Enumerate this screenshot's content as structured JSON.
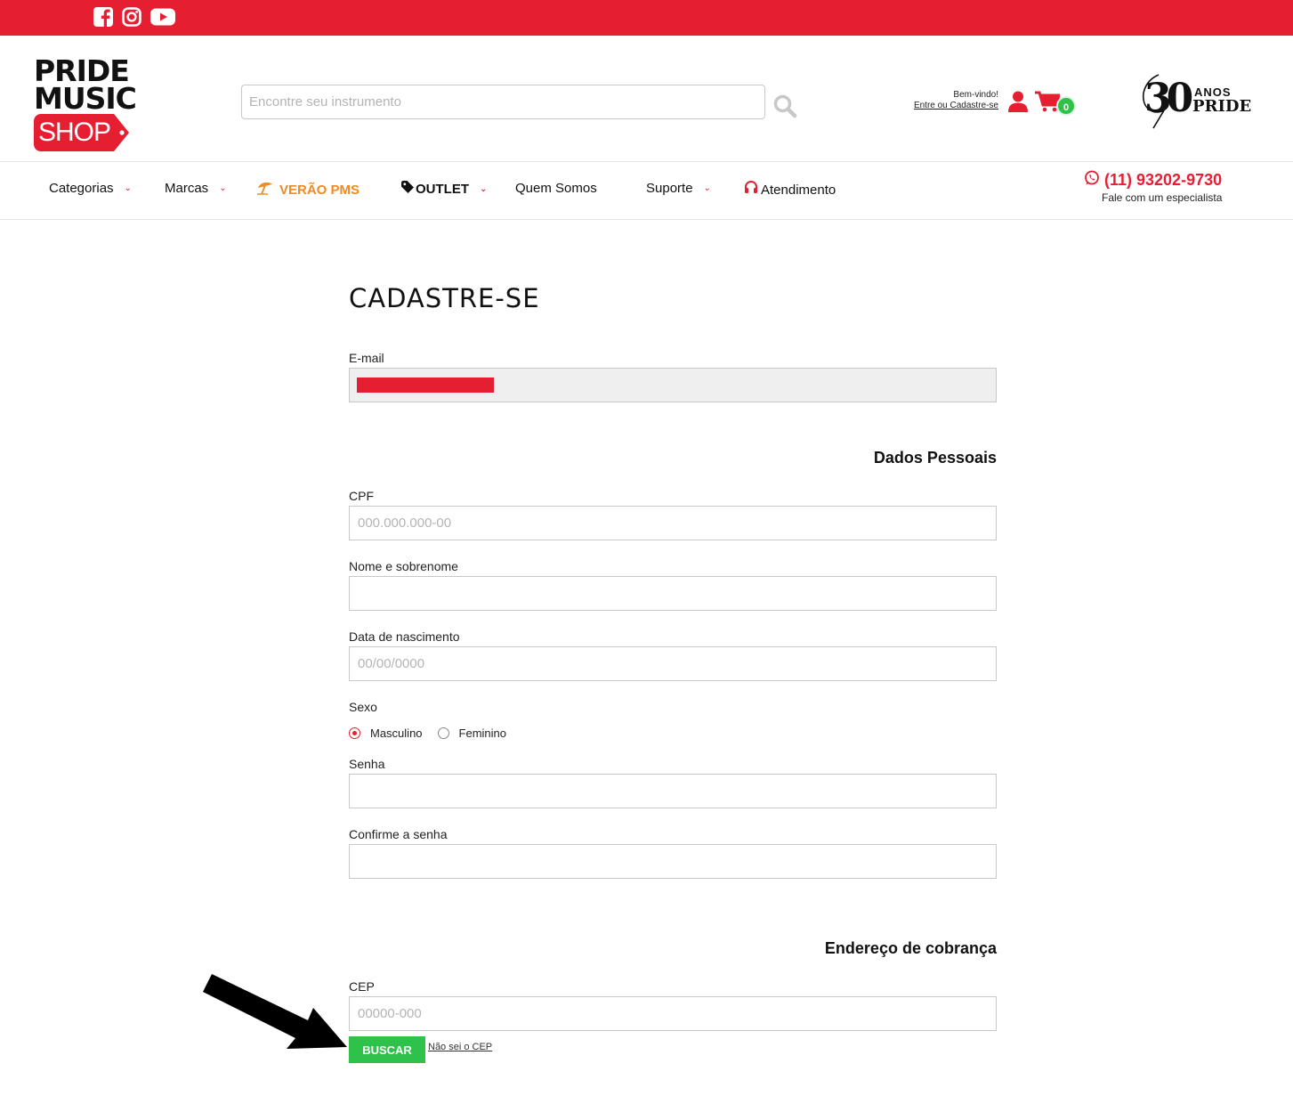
{
  "social": {
    "icons": [
      "facebook-icon",
      "instagram-icon",
      "youtube-icon"
    ]
  },
  "brand": {
    "logo_line1": "PRIDE",
    "logo_line2": "MUSIC",
    "logo_line3": "SHOP",
    "anos_number": "30",
    "anos_word": "ANOS",
    "anos_brand": "PRIDE"
  },
  "search": {
    "placeholder": "Encontre seu instrumento"
  },
  "account": {
    "welcome": "Bem-vindo!",
    "link": "Entre ou Cadastre-se",
    "cart_count": "0"
  },
  "nav": {
    "categorias": "Categorias",
    "marcas": "Marcas",
    "verao": "VERÃO PMS",
    "outlet": "OUTLET",
    "quem_somos": "Quem Somos",
    "suporte": "Suporte",
    "atendimento": "Atendimento",
    "phone": "(11) 93202-9730",
    "phone_sub": "Fale com um especialista"
  },
  "form": {
    "title": "CADASTRE-SE",
    "email_label": "E-mail",
    "section_personal": "Dados Pessoais",
    "cpf_label": "CPF",
    "cpf_placeholder": "000.000.000-00",
    "name_label": "Nome e sobrenome",
    "birth_label": "Data de nascimento",
    "birth_placeholder": "00/00/0000",
    "sex_label": "Sexo",
    "sex_options": [
      "Masculino",
      "Feminino"
    ],
    "sex_selected": "Masculino",
    "password_label": "Senha",
    "confirm_label": "Confirme a senha",
    "section_address": "Endereço de cobrança",
    "cep_label": "CEP",
    "cep_placeholder": "00000-000",
    "buscar": "BUSCAR",
    "nao_sei": "Não sei o CEP"
  },
  "colors": {
    "brand_red": "#e61e32",
    "accent_green": "#2ec24a",
    "verao_orange": "#f08a24"
  }
}
